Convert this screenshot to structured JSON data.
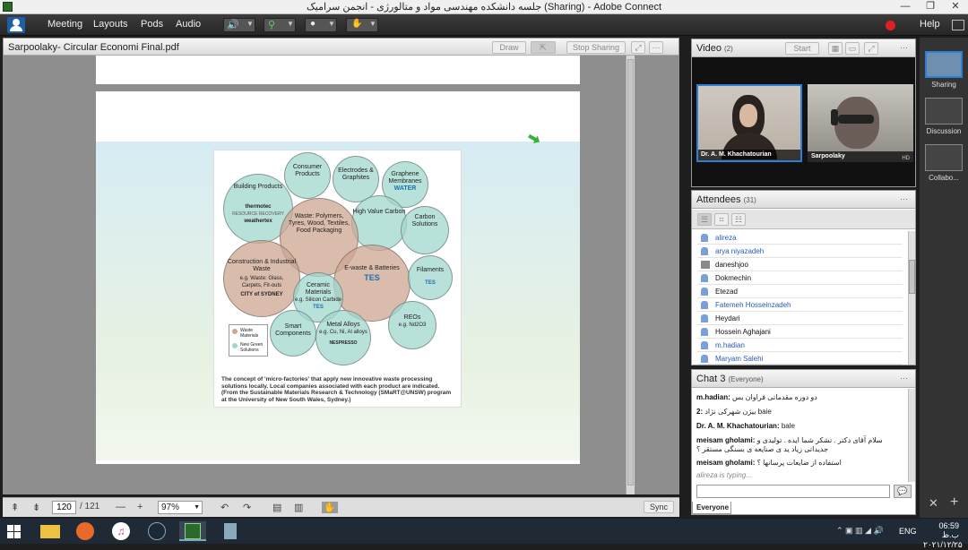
{
  "window": {
    "title": "جلسه دانشکده مهندسی مواد و متالورژی - انجمن سرامیک (Sharing) - Adobe Connect",
    "minimize": "—",
    "restore": "❐",
    "close": "✕"
  },
  "menubar": {
    "items": [
      "Meeting",
      "Layouts",
      "Pods",
      "Audio"
    ],
    "help": "Help"
  },
  "share": {
    "title": "Sarpoolaky- Circular Economi Final.pdf",
    "draw": "Draw",
    "stop_sharing": "Stop Sharing",
    "page_input": "120",
    "page_total": "/ 121",
    "zoom": "97%",
    "sync": "Sync"
  },
  "slide": {
    "circles": [
      "Consumer Products",
      "Electrodes & Graphites",
      "Graphene Membranes",
      "Building Products",
      "High Value Carbon",
      "Carbon Solutions",
      "Waste: Polymers, Tyres, Wood, Textiles, Food Packaging",
      "Construction & Industrial Waste",
      "e.g. Waste: Glass, Carpets, Fit-outs",
      "E-waste & Batteries",
      "Filaments",
      "Ceramic Materials",
      "e.g. Silicon Carbide",
      "Smart Components",
      "Metal Alloys",
      "e.g. Cu, Ni, Al alloys",
      "REOs",
      "e.g. Nd2O3"
    ],
    "logos": [
      "thermotec",
      "RESOURCE RECOVERY",
      "weathertex",
      "WATER",
      "TES",
      "TES",
      "TES",
      "CITY of SYDNEY",
      "NESPRESSO"
    ],
    "legend": [
      "Waste Materials",
      "New Green Solutions"
    ],
    "caption": "The concept of 'micro-factories' that apply new innovative waste processing solutions locally. Local companies associated with each product are indicated. (From the Sustainable Materials Research & Technology (SMaRT@UNSW) program at the University of New South Wales, Sydney.)"
  },
  "video": {
    "title": "Video",
    "count": "(2)",
    "start": "Start",
    "feeds": [
      "Dr. A. M. Khachatourian",
      "Sarpoolaky"
    ],
    "hd": "HD"
  },
  "attendees": {
    "title": "Attendees",
    "count": "(31)",
    "list": [
      {
        "name": "alireza",
        "color": "#2a5ab8"
      },
      {
        "name": "arya niyazadeh",
        "color": "#2a5ab8"
      },
      {
        "name": "daneshjoo",
        "color": "#111111"
      },
      {
        "name": "Dokmechin",
        "color": "#111111"
      },
      {
        "name": "Etezad",
        "color": "#111111"
      },
      {
        "name": "Fatemeh Hosseinzadeh",
        "color": "#2a5ab8"
      },
      {
        "name": "Heydari",
        "color": "#111111"
      },
      {
        "name": "Hossein Aghajani",
        "color": "#111111"
      },
      {
        "name": "m.hadian",
        "color": "#2a5ab8"
      },
      {
        "name": "Maryam Salehi",
        "color": "#2a5ab8"
      }
    ]
  },
  "chat": {
    "title": "Chat",
    "number": "3",
    "scope": "(Everyone)",
    "messages": [
      {
        "sender": "m.hadian:",
        "text": "دو دوره مقدماتی فراوان بس"
      },
      {
        "sender": "2:",
        "text": "بیژن شهرکی‌ نژاد baie"
      },
      {
        "sender": "Dr. A. M. Khachatourian:",
        "text": "bale"
      },
      {
        "sender": "meisam gholami:",
        "text": "سلام آقای دکتر . تشکر شما ایده . تولیدی و جدیداتی زیاد ید ی صنایعه ی بسنگی مستقر ؟"
      },
      {
        "sender": "meisam gholami:",
        "text": "استفاده از ضایعات پرسانها ؟"
      }
    ],
    "typing": "alireza is typing...",
    "recipient": "Everyone"
  },
  "sidebar": {
    "layouts": [
      "Sharing",
      "Discussion",
      "Collabo..."
    ]
  },
  "taskbar": {
    "lang": "ENG",
    "time": "06:59 ب.ظ",
    "date": "۲۰۲۱/۱۲/۲۵"
  },
  "colors": {
    "menubar": "#2b2b2b",
    "panel": "#ececec",
    "accent_blue": "#2a5ab8",
    "record_red": "#e02020",
    "taskbar": "#202a36"
  }
}
